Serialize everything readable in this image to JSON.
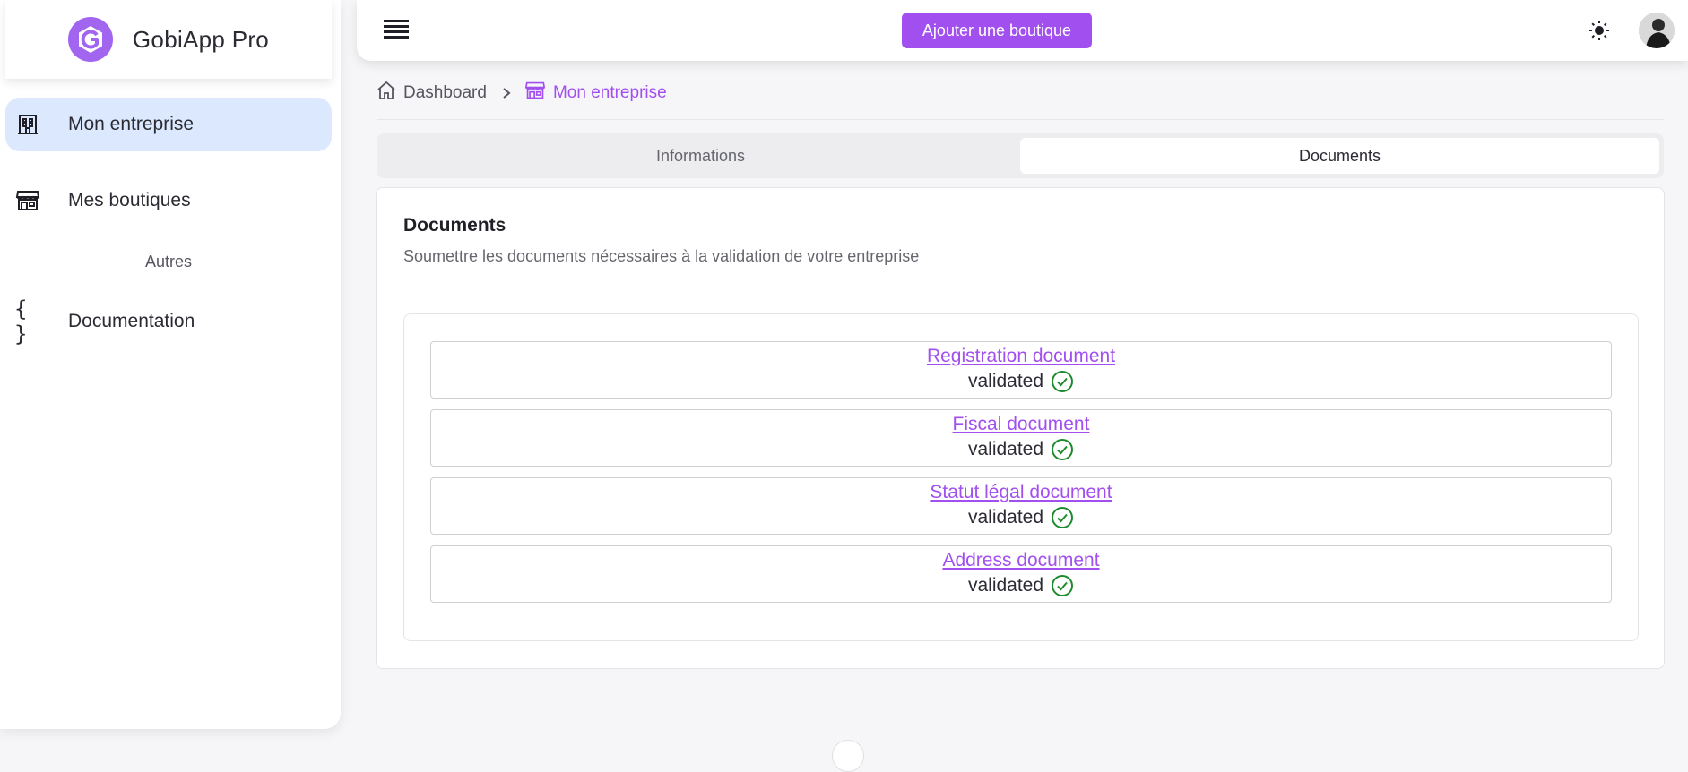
{
  "brand": {
    "name": "GobiApp Pro",
    "logo_icon": "gobiapp-logo-icon",
    "accent": "#a24fef"
  },
  "sidebar": {
    "items": [
      {
        "label": "Mon entreprise",
        "icon": "building-icon",
        "active": true
      },
      {
        "label": "Mes boutiques",
        "icon": "store-icon",
        "active": false
      }
    ],
    "section_label": "Autres",
    "extra_items": [
      {
        "label": "Documentation",
        "icon": "curly-braces-icon",
        "glyph": "{ }"
      }
    ]
  },
  "header": {
    "menu_icon": "hamburger-menu-icon",
    "add_shop_label": "Ajouter une boutique",
    "theme_icon": "sun-icon",
    "avatar_icon": "user-avatar"
  },
  "breadcrumb": {
    "home_label": "Dashboard",
    "home_icon": "home-icon",
    "separator_icon": "chevron-right-icon",
    "current_label": "Mon entreprise",
    "current_icon": "store-icon"
  },
  "tabs": [
    {
      "label": "Informations",
      "active": false
    },
    {
      "label": "Documents",
      "active": true
    }
  ],
  "documents_card": {
    "title": "Documents",
    "subtitle": "Soumettre les documents nécessaires à la validation de votre entreprise",
    "items": [
      {
        "name": "Registration document",
        "status": "validated"
      },
      {
        "name": "Fiscal document",
        "status": "validated"
      },
      {
        "name": "Statut légal document",
        "status": "validated"
      },
      {
        "name": "Address document",
        "status": "validated"
      }
    ],
    "status_icon": "check-circle-icon",
    "status_color": "#1e8a2e"
  }
}
